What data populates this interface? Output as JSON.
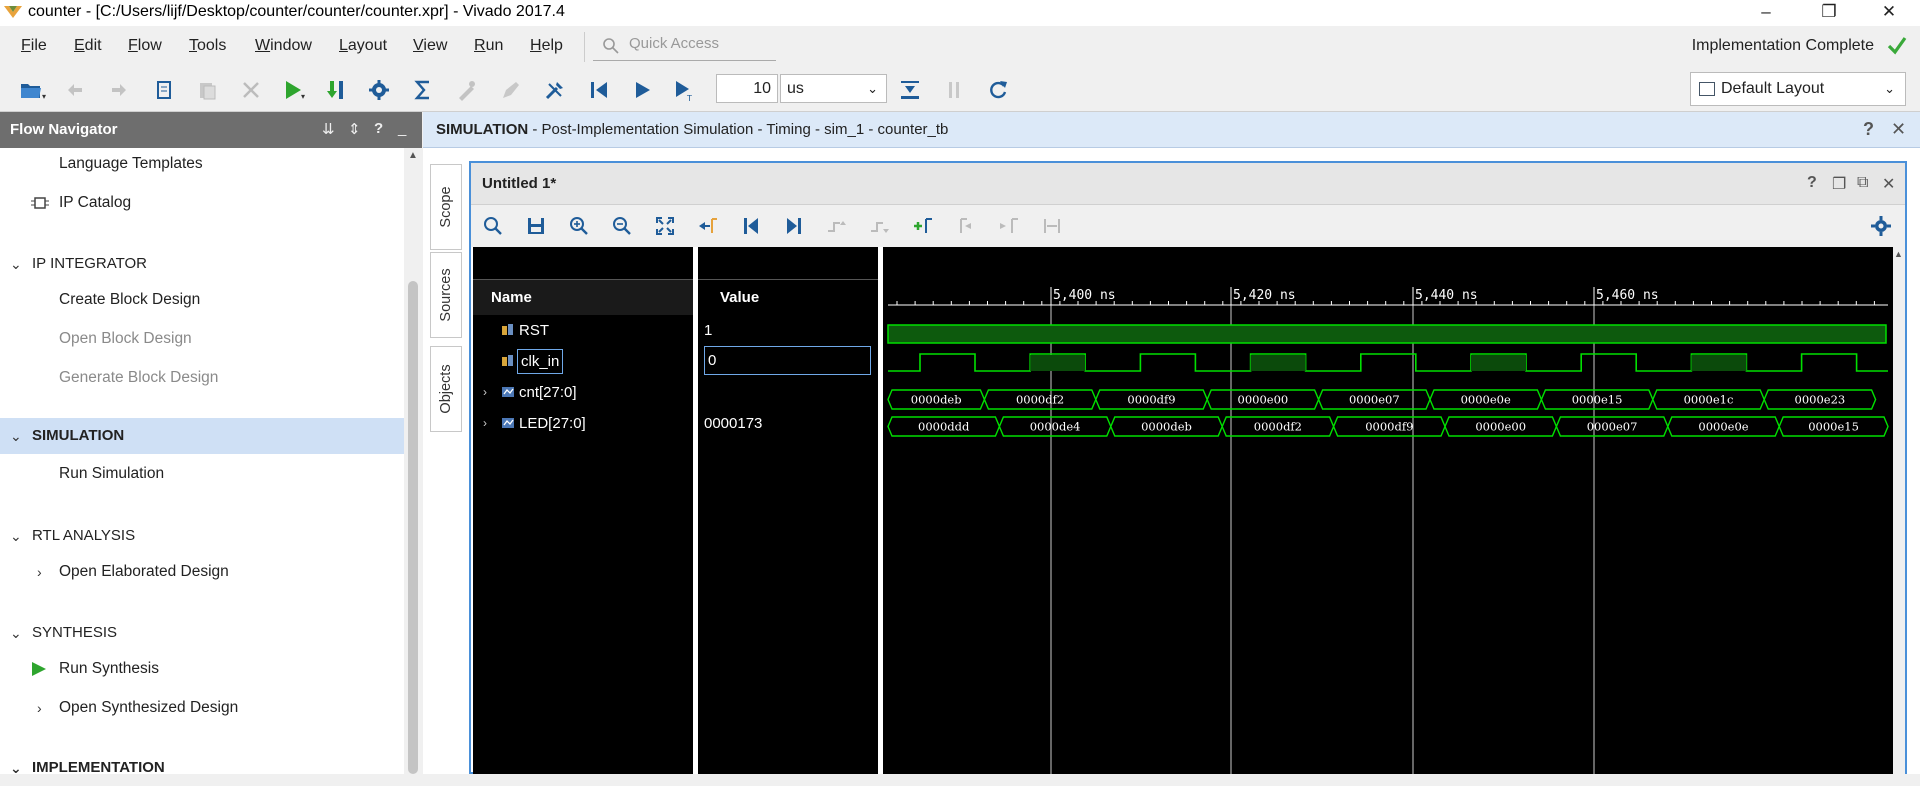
{
  "window": {
    "title": "counter - [C:/Users/lijf/Desktop/counter/counter/counter.xpr] - Vivado 2017.4",
    "minimize": "–",
    "restore": "❐",
    "close": "✕"
  },
  "menu": {
    "items": [
      {
        "label": "File",
        "u": "F",
        "rest": "ile"
      },
      {
        "label": "Edit",
        "u": "E",
        "rest": "dit"
      },
      {
        "label": "Flow",
        "u": "F",
        "rest": "low"
      },
      {
        "label": "Tools",
        "u": "T",
        "rest": "ools"
      },
      {
        "label": "Window",
        "u": "W",
        "rest": "indow"
      },
      {
        "label": "Layout",
        "u": "L",
        "rest": "ayout"
      },
      {
        "label": "View",
        "u": "V",
        "rest": "iew"
      },
      {
        "label": "Run",
        "u": "R",
        "rest": "un"
      },
      {
        "label": "Help",
        "u": "H",
        "rest": "elp"
      }
    ],
    "quick_access_placeholder": "Quick Access",
    "status": "Implementation Complete"
  },
  "toolbar": {
    "time_value": "10",
    "time_unit": "us",
    "layout": "Default Layout"
  },
  "flow_navigator": {
    "title": "Flow Navigator",
    "items": [
      {
        "label": "Language Templates",
        "type": "item",
        "state": "normal"
      },
      {
        "label": "IP Catalog",
        "type": "item",
        "state": "normal",
        "icon": "ip-catalog-icon"
      },
      {
        "label": "IP INTEGRATOR",
        "type": "section",
        "state": "expanded"
      },
      {
        "label": "Create Block Design",
        "type": "item",
        "state": "normal"
      },
      {
        "label": "Open Block Design",
        "type": "item",
        "state": "disabled"
      },
      {
        "label": "Generate Block Design",
        "type": "item",
        "state": "disabled"
      },
      {
        "label": "SIMULATION",
        "type": "section",
        "state": "selected"
      },
      {
        "label": "Run Simulation",
        "type": "item",
        "state": "normal"
      },
      {
        "label": "RTL ANALYSIS",
        "type": "section",
        "state": "expanded"
      },
      {
        "label": "Open Elaborated Design",
        "type": "item",
        "state": "collapsible"
      },
      {
        "label": "SYNTHESIS",
        "type": "section",
        "state": "expanded"
      },
      {
        "label": "Run Synthesis",
        "type": "item",
        "state": "normal",
        "icon": "run-icon"
      },
      {
        "label": "Open Synthesized Design",
        "type": "item",
        "state": "collapsible"
      },
      {
        "label": "IMPLEMENTATION",
        "type": "section",
        "state": "expanded"
      }
    ]
  },
  "simulation": {
    "header_bold": "SIMULATION",
    "header_rest": " - Post-Implementation Simulation - Timing - sim_1 - counter_tb",
    "side_tabs": [
      "Scope",
      "Sources",
      "Objects"
    ],
    "wave_window": {
      "title": "Untitled 1*",
      "columns": {
        "name": "Name",
        "value": "Value"
      },
      "signals": [
        {
          "name": "RST",
          "value": "1",
          "kind": "bit",
          "expandable": false,
          "selected": false
        },
        {
          "name": "clk_in",
          "value": "0",
          "kind": "bit",
          "expandable": false,
          "selected": true
        },
        {
          "name": "cnt[27:0]",
          "value": "",
          "kind": "bus",
          "expandable": true,
          "selected": false
        },
        {
          "name": "LED[27:0]",
          "value": "0000173",
          "kind": "bus",
          "expandable": true,
          "selected": false
        }
      ],
      "time_labels": [
        "5,400 ns",
        "5,420 ns",
        "5,440 ns",
        "5,460 ns"
      ],
      "cnt_values": [
        "0000deb",
        "0000df2",
        "0000df9",
        "0000e00",
        "0000e07",
        "0000e0e",
        "0000e15",
        "0000e1c",
        "0000e23"
      ],
      "led_values": [
        "0000ddd",
        "0000de4",
        "0000deb",
        "0000df2",
        "0000df9",
        "0000e00",
        "0000e07",
        "0000e0e",
        "0000e15"
      ],
      "colors": {
        "wave": "#00e000",
        "cursor": "#ffffff",
        "background": "#000000"
      }
    }
  }
}
